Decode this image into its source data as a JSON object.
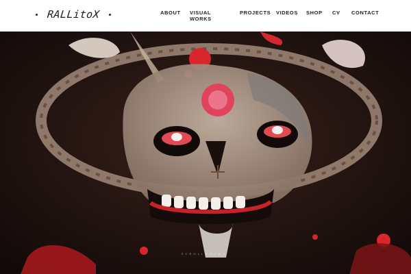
{
  "brand": {
    "logo_text": "RALLitoX"
  },
  "nav": {
    "about": "ABOUT",
    "visual_works": "VISUAL WORKS",
    "projects": "PROJECTS",
    "videos": "VIDEOS",
    "shop": "SHOP",
    "cv": "CV",
    "contact": "CONTACT"
  },
  "hero": {
    "caption": "S C R O L L   ▼   D O W N"
  },
  "colors": {
    "header_bg": "#ffffff",
    "nav_text": "#222222",
    "painting_dark": "#1b0f0d",
    "painting_red": "#d8262c",
    "painting_bone": "#b9a492"
  }
}
